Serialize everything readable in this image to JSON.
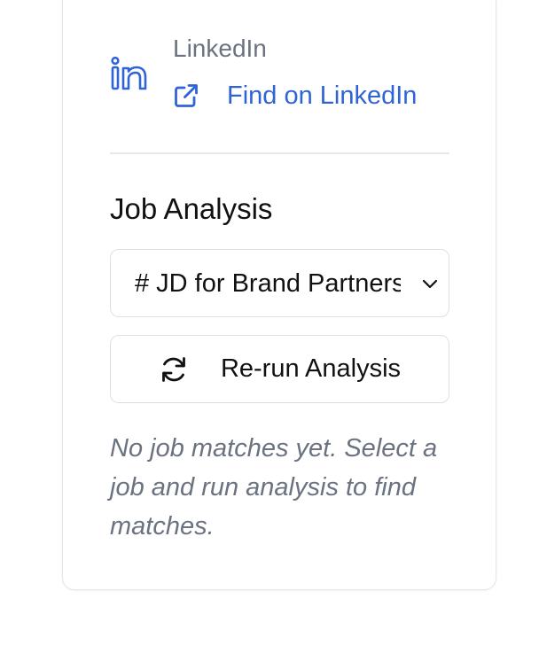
{
  "linkedin": {
    "label": "LinkedIn",
    "link_text": "Find on LinkedIn",
    "icon": "linkedin-icon",
    "link_icon": "external-link-icon"
  },
  "job_analysis": {
    "title": "Job Analysis",
    "selected_job": "# JD for Brand Partnerships",
    "select_icon": "chevron-down-icon",
    "rerun_label": "Re-run Analysis",
    "rerun_icon": "refresh-icon",
    "empty_message": "No job matches yet. Select a job and run analysis to find matches."
  },
  "colors": {
    "accent": "#2f63d6",
    "muted_text": "#6b7280",
    "border": "#dcdfe4"
  }
}
